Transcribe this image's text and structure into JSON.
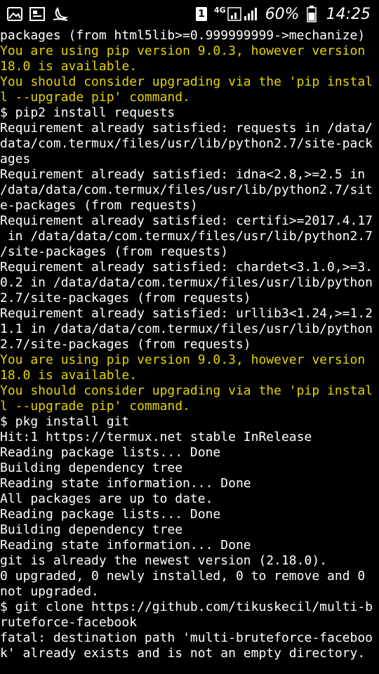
{
  "status_bar": {
    "network_type": "4G",
    "battery_percent": "60%",
    "time": "14:25",
    "sim_slot": "1",
    "icons": [
      "image-icon",
      "gallery-icon",
      "night-mode-icon",
      "sim-icon",
      "signal-icon",
      "battery-icon"
    ]
  },
  "colors": {
    "background": "#000000",
    "text": "#ffffff",
    "warning": "#e6d400"
  },
  "terminal": {
    "lines": [
      {
        "text": "packages (from html5lib>=0.999999999->mechanize)",
        "color": "white"
      },
      {
        "text": "You are using pip version 9.0.3, however version",
        "color": "yellow"
      },
      {
        "text": "18.0 is available.",
        "color": "yellow"
      },
      {
        "text": "You should consider upgrading via the 'pip instal",
        "color": "yellow"
      },
      {
        "text": "l --upgrade pip' command.",
        "color": "yellow"
      },
      {
        "text": "$ pip2 install requests",
        "color": "white"
      },
      {
        "text": "Requirement already satisfied: requests in /data/",
        "color": "white"
      },
      {
        "text": "data/com.termux/files/usr/lib/python2.7/site-pack",
        "color": "white"
      },
      {
        "text": "ages",
        "color": "white"
      },
      {
        "text": "Requirement already satisfied: idna<2.8,>=2.5 in",
        "color": "white"
      },
      {
        "text": "/data/data/com.termux/files/usr/lib/python2.7/sit",
        "color": "white"
      },
      {
        "text": "e-packages (from requests)",
        "color": "white"
      },
      {
        "text": "Requirement already satisfied: certifi>=2017.4.17",
        "color": "white"
      },
      {
        "text": " in /data/data/com.termux/files/usr/lib/python2.7",
        "color": "white"
      },
      {
        "text": "/site-packages (from requests)",
        "color": "white"
      },
      {
        "text": "Requirement already satisfied: chardet<3.1.0,>=3.",
        "color": "white"
      },
      {
        "text": "0.2 in /data/data/com.termux/files/usr/lib/python",
        "color": "white"
      },
      {
        "text": "2.7/site-packages (from requests)",
        "color": "white"
      },
      {
        "text": "Requirement already satisfied: urllib3<1.24,>=1.2",
        "color": "white"
      },
      {
        "text": "1.1 in /data/data/com.termux/files/usr/lib/python",
        "color": "white"
      },
      {
        "text": "2.7/site-packages (from requests)",
        "color": "white"
      },
      {
        "text": "You are using pip version 9.0.3, however version",
        "color": "yellow"
      },
      {
        "text": "18.0 is available.",
        "color": "yellow"
      },
      {
        "text": "You should consider upgrading via the 'pip instal",
        "color": "yellow"
      },
      {
        "text": "l --upgrade pip' command.",
        "color": "yellow"
      },
      {
        "text": "$ pkg install git",
        "color": "white"
      },
      {
        "text": "Hit:1 https://termux.net stable InRelease",
        "color": "white"
      },
      {
        "text": "Reading package lists... Done",
        "color": "white"
      },
      {
        "text": "Building dependency tree",
        "color": "white"
      },
      {
        "text": "Reading state information... Done",
        "color": "white"
      },
      {
        "text": "All packages are up to date.",
        "color": "white"
      },
      {
        "text": "Reading package lists... Done",
        "color": "white"
      },
      {
        "text": "Building dependency tree",
        "color": "white"
      },
      {
        "text": "Reading state information... Done",
        "color": "white"
      },
      {
        "text": "git is already the newest version (2.18.0).",
        "color": "white"
      },
      {
        "text": "0 upgraded, 0 newly installed, 0 to remove and 0",
        "color": "white"
      },
      {
        "text": "not upgraded.",
        "color": "white"
      },
      {
        "text": "$ git clone https://github.com/tikuskecil/multi-b",
        "color": "white"
      },
      {
        "text": "ruteforce-facebook",
        "color": "white"
      },
      {
        "text": "fatal: destination path 'multi-bruteforce-faceboo",
        "color": "white"
      },
      {
        "text": "k' already exists and is not an empty directory.",
        "color": "white"
      }
    ]
  }
}
